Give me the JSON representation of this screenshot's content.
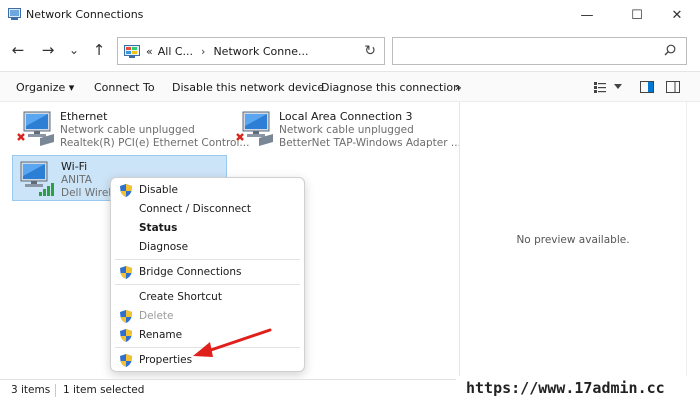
{
  "window": {
    "title": "Network Connections",
    "controls": {
      "minimize": "—",
      "maximize": "☐",
      "close": "✕"
    }
  },
  "nav": {
    "back": "←",
    "forward": "→",
    "recent": "⌄",
    "up": "↑",
    "address": {
      "prefix": "«",
      "crumb1": "All C...",
      "separator": "›",
      "crumb2": "Network Conne..."
    },
    "refresh": "↻",
    "search_placeholder": ""
  },
  "commands": {
    "organize": "Organize ▾",
    "connect_to": "Connect To",
    "disable": "Disable this network device",
    "diagnose": "Diagnose this connection",
    "more": "»"
  },
  "connections": [
    {
      "name": "Ethernet",
      "status": "Network cable unplugged",
      "device": "Realtek(R) PCI(e) Ethernet Control...",
      "state": "unplugged"
    },
    {
      "name": "Local Area Connection 3",
      "status": "Network cable unplugged",
      "device": "BetterNet TAP-Windows Adapter ...",
      "state": "unplugged"
    },
    {
      "name": "Wi-Fi",
      "status": "ANITA",
      "device": "Dell Wirele",
      "state": "connected",
      "selected": true
    }
  ],
  "context_menu": {
    "items": [
      {
        "label": "Disable",
        "shield": true,
        "style": "normal"
      },
      {
        "label": "Connect / Disconnect",
        "shield": false,
        "style": "normal"
      },
      {
        "label": "Status",
        "shield": false,
        "style": "bold"
      },
      {
        "label": "Diagnose",
        "shield": false,
        "style": "normal"
      },
      {
        "label": "Bridge Connections",
        "shield": true,
        "style": "normal"
      },
      {
        "label": "Create Shortcut",
        "shield": false,
        "style": "normal"
      },
      {
        "label": "Delete",
        "shield": true,
        "style": "disabled"
      },
      {
        "label": "Rename",
        "shield": true,
        "style": "normal"
      },
      {
        "label": "Properties",
        "shield": true,
        "style": "normal"
      }
    ]
  },
  "preview": {
    "message": "No preview available."
  },
  "status": {
    "count": "3 items",
    "selection": "1 item selected"
  },
  "watermark": "https://www.17admin.cc",
  "colors": {
    "accent": "#0078d4",
    "selection": "#cce4f7",
    "arrow": "#e0201b"
  }
}
